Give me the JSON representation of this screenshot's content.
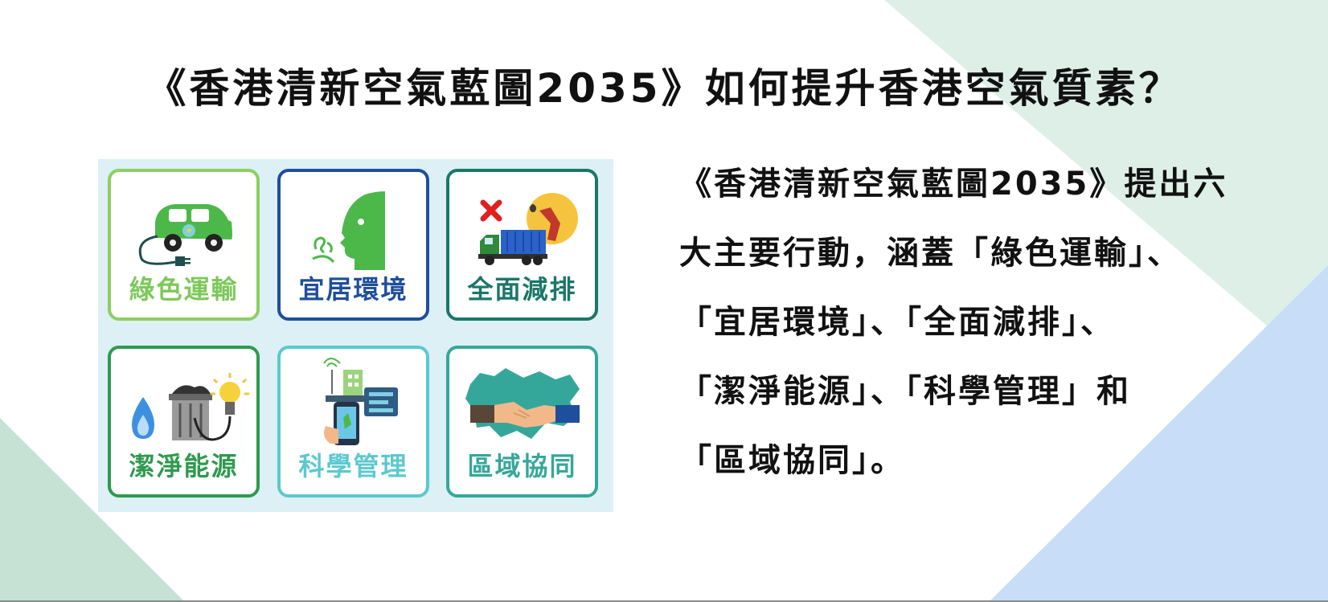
{
  "title": "《香港清新空氣藍圖2035》如何提升香港空氣質素？",
  "cards": [
    {
      "label": "綠色運輸",
      "icon": "electric-car-icon"
    },
    {
      "label": "宜居環境",
      "icon": "human-head-breathing-icon"
    },
    {
      "label": "全面減排",
      "icon": "truck-no-diesel-icon"
    },
    {
      "label": "潔淨能源",
      "icon": "flame-bin-bulb-icon"
    },
    {
      "label": "科學管理",
      "icon": "phone-data-icon"
    },
    {
      "label": "區域協同",
      "icon": "handshake-map-icon"
    }
  ],
  "paragraph": {
    "lines": [
      "《香港清新空氣藍圖2035》提出六",
      "大主要行動，涵蓋「綠色運輸」、",
      "「宜居環境」、「全面減排」、",
      "「潔淨能源」、「科學管理」和",
      "「區域協同」。"
    ]
  },
  "colors": {
    "green_transport": "#7dc85a",
    "livable": "#1f4e9c",
    "emission": "#1b7768",
    "clean_energy": "#2e9a4e",
    "science": "#5cc8cf",
    "regional": "#35a79a",
    "panel_bg": "#dcf0f5"
  }
}
